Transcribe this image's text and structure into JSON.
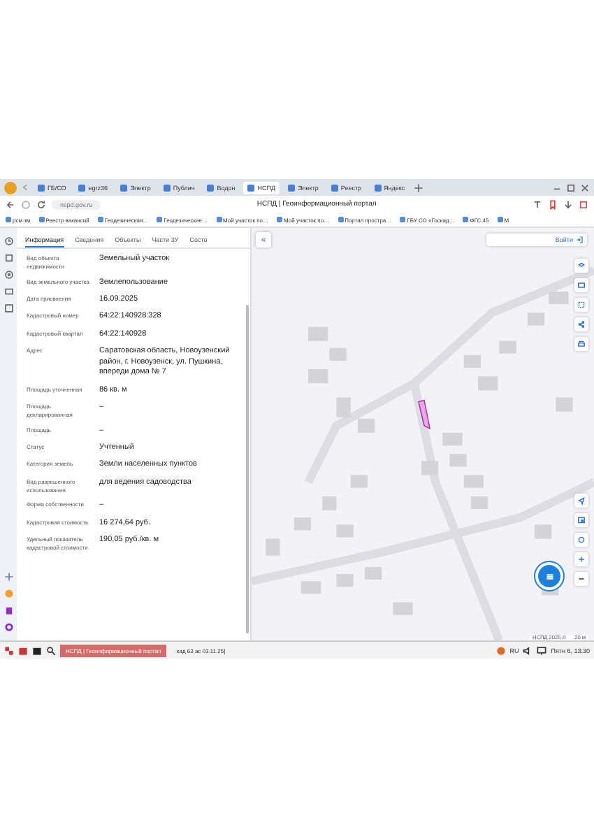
{
  "browser": {
    "tabs": [
      {
        "label": "ГБ/СО",
        "selected": false
      },
      {
        "label": "egrz36",
        "selected": false
      },
      {
        "label": "Электр",
        "selected": false
      },
      {
        "label": "Публич",
        "selected": false
      },
      {
        "label": "Водон",
        "selected": false
      },
      {
        "label": "НСПД",
        "selected": true
      },
      {
        "label": "Электр",
        "selected": false
      },
      {
        "label": "Реестр",
        "selected": false
      },
      {
        "label": "Яндекс",
        "selected": false
      }
    ],
    "address": "nspd.gov.ru",
    "page_title": "НСПД | Геоинформационный портал",
    "bookmarks": [
      "рсм.зм",
      "Реестр вакансий",
      "Геодезическая…",
      "Геодезические…",
      "Мой участок по…",
      "Мой участок по…",
      "Портал простра…",
      "ГБУ СО «Госкад…",
      "ФГС 45",
      "М"
    ]
  },
  "panel": {
    "tabs": [
      {
        "label": "Информация",
        "selected": true
      },
      {
        "label": "Сведения",
        "selected": false
      },
      {
        "label": "Объекты",
        "selected": false
      },
      {
        "label": "Части ЗУ",
        "selected": false
      },
      {
        "label": "Состо",
        "selected": false
      }
    ],
    "rows": [
      {
        "label": "Вид объекта недвижимости",
        "value": "Земельный участок"
      },
      {
        "label": "Вид земельного участка",
        "value": "Землепользование"
      },
      {
        "label": "Дата присвоения",
        "value": "16.09.2025"
      },
      {
        "label": "Кадастровый номер",
        "value": "64:22:140928:328"
      },
      {
        "label": "Кадастровый квартал",
        "value": "64:22:140928"
      },
      {
        "label": "Адрес",
        "value": "Саратовская область, Новоузенский район, г. Новоузенск, ул. Пушкина, впереди дома № 7"
      },
      {
        "label": "Площадь уточненная",
        "value": "86 кв. м"
      },
      {
        "label": "Площадь декларированная",
        "value": "–"
      },
      {
        "label": "Площадь",
        "value": "–"
      },
      {
        "label": "Статус",
        "value": "Учтенный"
      },
      {
        "label": "Категория земель",
        "value": "Земли населенных пунктов"
      },
      {
        "label": "Вид разрешенного использования",
        "value": "для ведения садоводства"
      },
      {
        "label": "Форма собственности",
        "value": "–"
      },
      {
        "label": "Кадастровая стоимость",
        "value": "16 274,64 руб."
      },
      {
        "label": "Удельный показатель кадастровой стоимости",
        "value": "190,05 руб./кв. м"
      }
    ]
  },
  "map": {
    "kind": "picture",
    "collapse": "«",
    "login": "Войти",
    "attribution": "НСПД 2025 ©",
    "scale": "20 м"
  },
  "taskbar": {
    "items": [
      {
        "label": "НСПД | Геоинформационный портал",
        "selected": true
      },
      {
        "label": "кад 63 ас 03.11.25]",
        "selected": false
      }
    ],
    "language": "RU",
    "clock": "Пятн 6, 13:30"
  }
}
